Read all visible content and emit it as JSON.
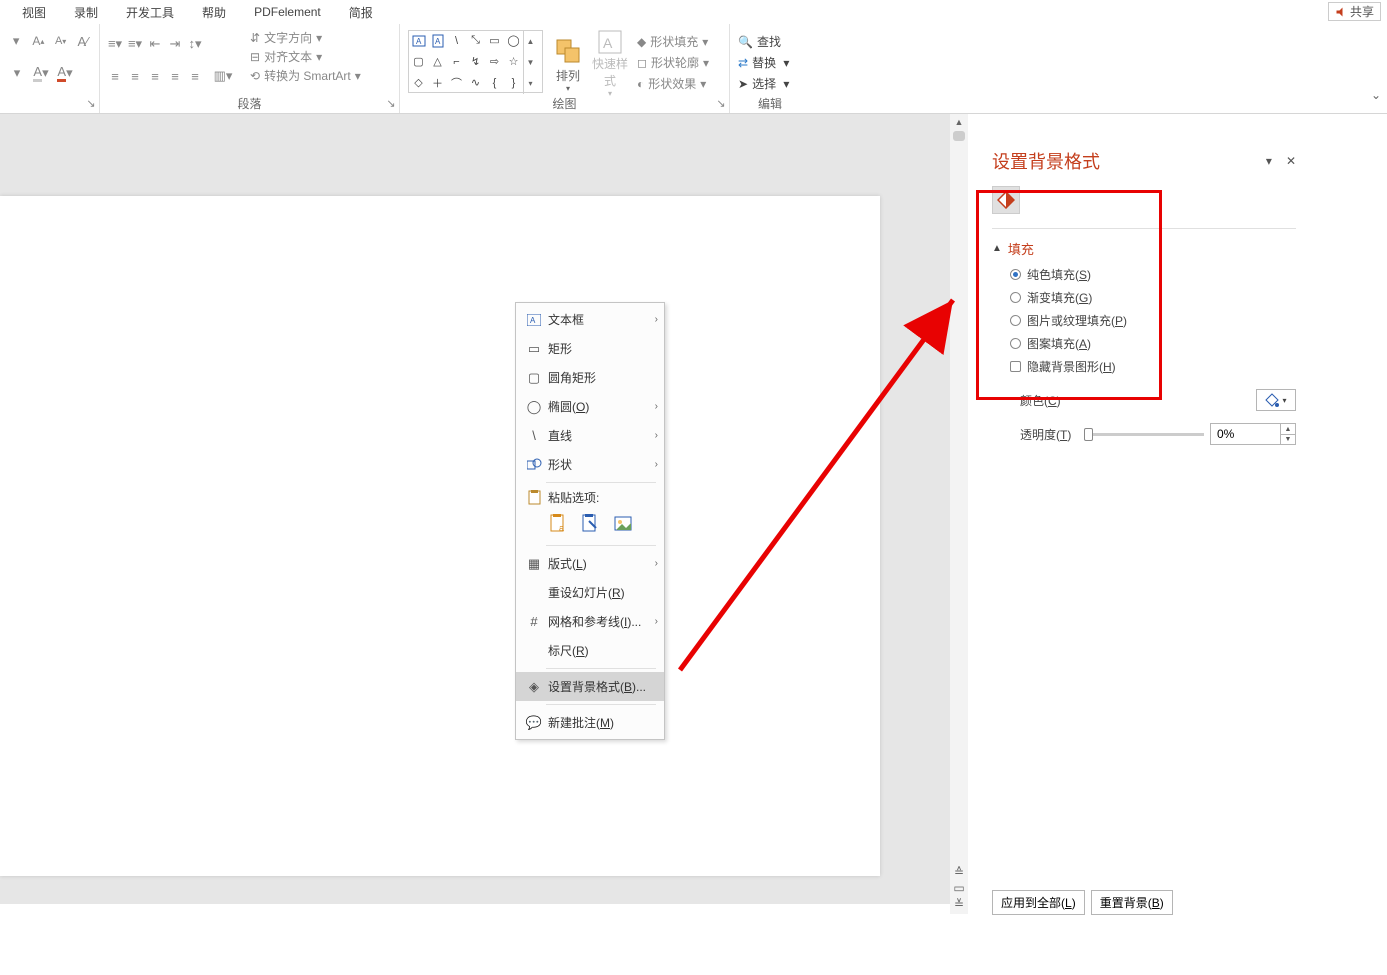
{
  "ribbon": {
    "tabs": [
      "视图",
      "录制",
      "开发工具",
      "帮助",
      "PDFelement",
      "简报"
    ],
    "share": "共享",
    "groups": {
      "paragraph": {
        "text_direction": "文字方向",
        "align_text": "对齐文本",
        "convert_smartart": "转换为 SmartArt",
        "label": "段落"
      },
      "drawing": {
        "arrange": "排列",
        "quick_styles": "快速样式",
        "shape_fill": "形状填充",
        "shape_outline": "形状轮廓",
        "shape_effects": "形状效果",
        "label": "绘图"
      },
      "editing": {
        "find": "查找",
        "replace": "替换",
        "select": "选择",
        "label": "编辑"
      }
    }
  },
  "context_menu": {
    "textbox": "文本框",
    "rectangle": "矩形",
    "rounded_rect": "圆角矩形",
    "oval": "椭圆(O)",
    "line": "直线",
    "shape": "形状",
    "paste_options": "粘贴选项:",
    "layout": "版式(L)",
    "reset_slide": "重设幻灯片(R)",
    "grid_guides": "网格和参考线(I)...",
    "ruler": "标尺(R)",
    "format_background": "设置背景格式(B)...",
    "new_comment": "新建批注(M)"
  },
  "task_pane": {
    "title": "设置背景格式",
    "fill_header": "填充",
    "solid_fill": "纯色填充(S)",
    "gradient_fill": "渐变填充(G)",
    "picture_fill": "图片或纹理填充(P)",
    "pattern_fill": "图案填充(A)",
    "hide_bg": "隐藏背景图形(H)",
    "color": "颜色(C)",
    "transparency": "透明度(T)",
    "transparency_value": "0%",
    "apply_all": "应用到全部(L)",
    "reset_bg": "重置背景(B)"
  }
}
